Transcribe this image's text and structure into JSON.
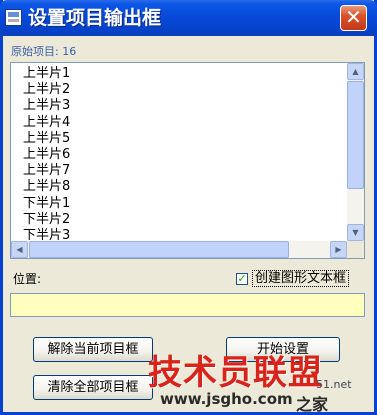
{
  "window": {
    "title": "设置项目输出框",
    "close_glyph": "✕"
  },
  "original_items": {
    "label": "原始项目: 16"
  },
  "list": {
    "items": [
      "上半片1",
      "上半片2",
      "上半片3",
      "上半片4",
      "上半片5",
      "上半片6",
      "上半片7",
      "上半片8",
      "下半片1",
      "下半片2",
      "下半片3"
    ]
  },
  "position": {
    "label": "位置:",
    "value": ""
  },
  "create_text_frame": {
    "label": "创建图形文本框",
    "checked": true,
    "check_glyph": "✓"
  },
  "buttons": {
    "remove_current": "解除当前项目框",
    "start_setup": "开始设置",
    "clear_all": "清除全部项目框"
  },
  "scrollbar": {
    "up": "▲",
    "down": "▼",
    "left": "◀",
    "right": "▶"
  },
  "watermark": {
    "brand": "技术员联盟",
    "domain_suffix": "51.net",
    "url": "www.jsgho.com",
    "home": "之家"
  }
}
